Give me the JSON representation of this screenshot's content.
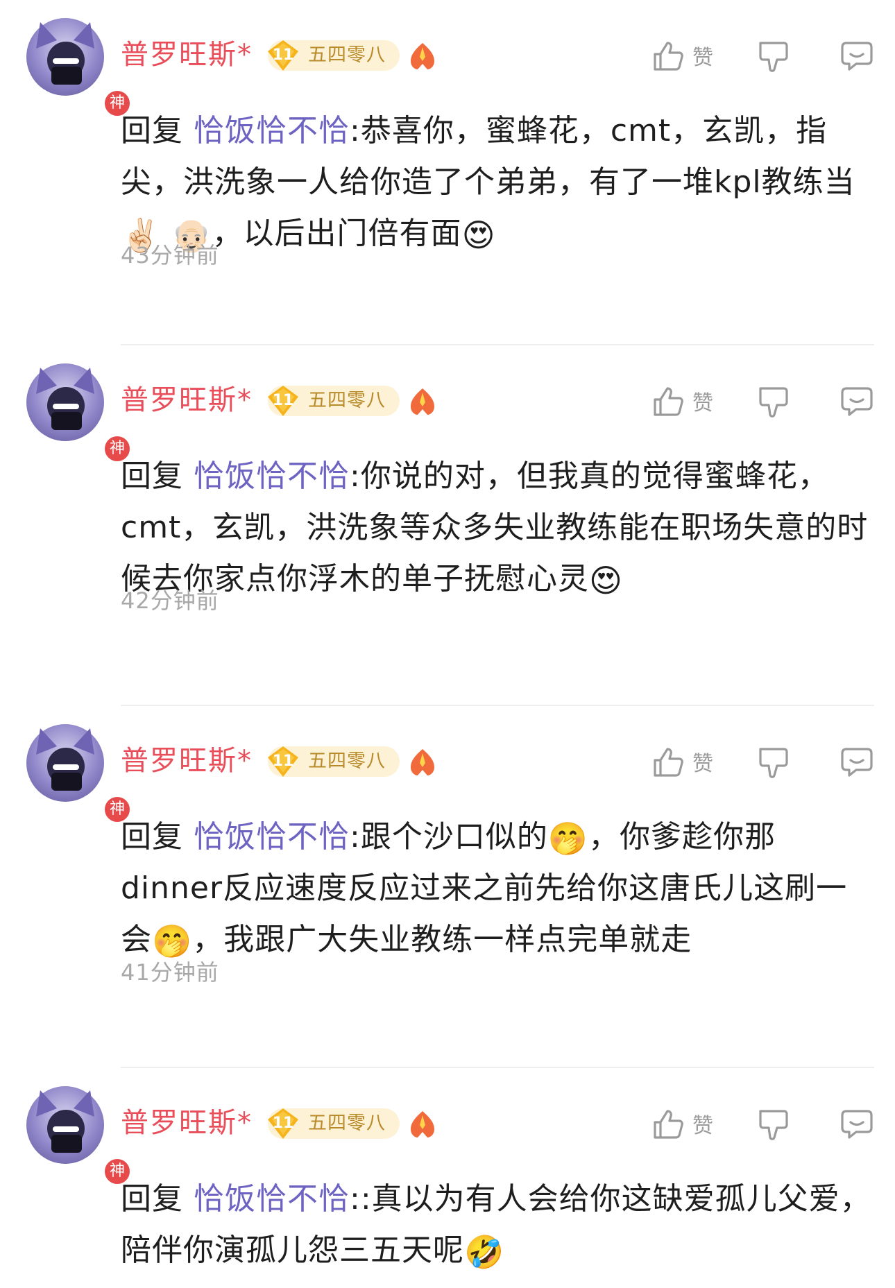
{
  "colors": {
    "username": "#e94d59",
    "mention": "#6d63c2",
    "body_text": "#1e1e1e",
    "timestamp": "#a8a8a8",
    "level_badge_bg": "#fdf1d6",
    "level_badge_text": "#b88a2a",
    "god_badge": "#e74a4a"
  },
  "comments": [
    {
      "username": "普罗旺斯*",
      "god_badge": "神",
      "level": "11",
      "level_name": "五四零八",
      "like_label": "赞",
      "reply_prefix": "回复 ",
      "mention": "恰饭恰不恰",
      "parts": [
        ":恭喜你，蜜蜂花，cmt，玄凯，指尖，洪洗象一人给你造了个弟弟，有了一堆kpl教练当",
        "✌🏻",
        " ",
        "👴🏻",
        "，以后出门倍有面",
        "😍"
      ],
      "time": "43分钟前"
    },
    {
      "username": "普罗旺斯*",
      "god_badge": "神",
      "level": "11",
      "level_name": "五四零八",
      "like_label": "赞",
      "reply_prefix": "回复 ",
      "mention": "恰饭恰不恰",
      "parts": [
        ":你说的对，但我真的觉得蜜蜂花，cmt，玄凯，洪洗象等众多失业教练能在职场失意的时候去你家点你浮木的单子抚慰心灵",
        "😍"
      ],
      "time": "42分钟前"
    },
    {
      "username": "普罗旺斯*",
      "god_badge": "神",
      "level": "11",
      "level_name": "五四零八",
      "like_label": "赞",
      "reply_prefix": "回复 ",
      "mention": "恰饭恰不恰",
      "parts": [
        ":跟个沙口似的",
        "🤭",
        "，你爹趁你那dinner反应速度反应过来之前先给你这唐氏儿这刷一会",
        "🤭",
        "，我跟广大失业教练一样点完单就走"
      ],
      "time": "41分钟前"
    },
    {
      "username": "普罗旺斯*",
      "god_badge": "神",
      "level": "11",
      "level_name": "五四零八",
      "like_label": "赞",
      "reply_prefix": "回复 ",
      "mention": "恰饭恰不恰",
      "parts": [
        "::真以为有人会给你这缺爱孤儿父爱，陪伴你演孤儿怨三五天呢",
        "🤣"
      ],
      "time": ""
    }
  ]
}
